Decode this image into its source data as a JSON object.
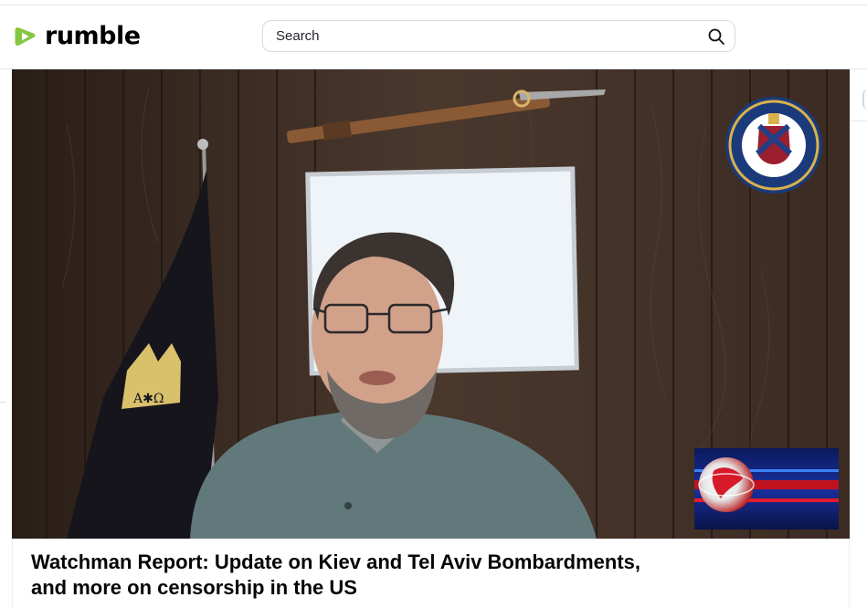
{
  "header": {
    "logo_text": "rumble",
    "search_placeholder": "Search"
  },
  "video": {
    "title_line1": "Watchman Report: Update on Kiev and Tel Aviv Bombardments,",
    "title_line2": "and more on censorship in the US",
    "overlay_emblem_name": "institute-of-peace-studies-seal",
    "overlay_news_globe": "breaking-news-globe-graphic"
  },
  "colors": {
    "brand_green": "#85c742",
    "title_text": "#050505",
    "wood_wall": "#3a2c24"
  }
}
